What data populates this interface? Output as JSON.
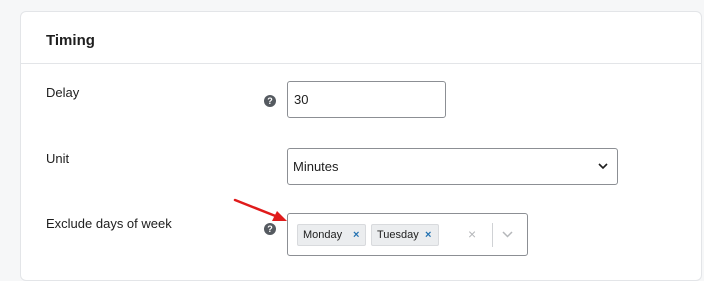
{
  "panel": {
    "title": "Timing"
  },
  "fields": {
    "delay": {
      "label": "Delay",
      "value": "30"
    },
    "unit": {
      "label": "Unit",
      "selected": "Minutes"
    },
    "exclude_days": {
      "label": "Exclude days of week",
      "selected": [
        "Monday",
        "Tuesday"
      ]
    }
  },
  "icons": {
    "help": "?",
    "chip_remove": "×",
    "clear": "×",
    "chevron_down": "∨"
  },
  "colors": {
    "annotation_arrow": "#e01b1b",
    "chip_remove": "#2271b1",
    "help_icon": "#555a60"
  }
}
